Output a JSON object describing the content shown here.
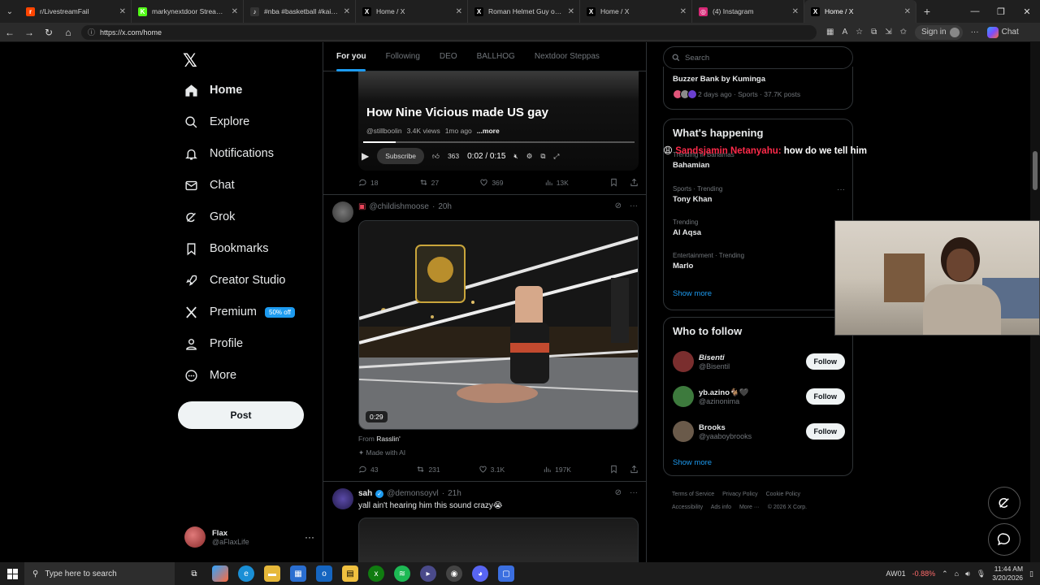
{
  "browser": {
    "tabs": [
      {
        "title": "r/LivestreamFail",
        "fav": "r",
        "color": "#ff4500"
      },
      {
        "title": "markynextdoor Stream - Wa",
        "fav": "K",
        "color": "#53fc18"
      },
      {
        "title": "#nba #basketball #kaijones",
        "fav": "♪",
        "color": "#333333"
      },
      {
        "title": "Home / X",
        "fav": "X",
        "color": "#000000"
      },
      {
        "title": "Roman Helmet Guy on X: \"",
        "fav": "X",
        "color": "#000000"
      },
      {
        "title": "Home / X",
        "fav": "X",
        "color": "#000000"
      },
      {
        "title": "(4) Instagram",
        "fav": "◎",
        "color": "#d62976"
      },
      {
        "title": "Home / X",
        "fav": "X",
        "color": "#000000"
      }
    ],
    "url": "https://x.com/home",
    "sign_in": "Sign in",
    "chat": "Chat"
  },
  "sidebar": {
    "items": [
      {
        "label": "Home"
      },
      {
        "label": "Explore"
      },
      {
        "label": "Notifications"
      },
      {
        "label": "Chat"
      },
      {
        "label": "Grok"
      },
      {
        "label": "Bookmarks"
      },
      {
        "label": "Creator Studio"
      },
      {
        "label": "Premium"
      },
      {
        "label": "Profile"
      },
      {
        "label": "More"
      }
    ],
    "premium_badge": "50% off",
    "post_button": "Post",
    "account": {
      "name": "Flax",
      "handle": "@aFlaxLife"
    }
  },
  "feed": {
    "tabs": [
      "For you",
      "Following",
      "DEO",
      "BALLHOG",
      "Nextdoor Steppas"
    ],
    "video1": {
      "title": "How Nine Vicious made US gay",
      "channel": "@stillboolin",
      "views": "3.4K views",
      "ago": "1mo ago",
      "more": "...more",
      "subscribe": "Subscribe",
      "likes": "363",
      "time": "0:02 / 0:15",
      "progress": 0.12
    },
    "post1_actions": {
      "replies": "18",
      "reposts": "27",
      "likes": "369",
      "views": "13K"
    },
    "post2": {
      "handle": "@childishmoose",
      "time": "20h",
      "duration": "0:29",
      "from_label": "From",
      "from_source": "Rasslin'",
      "made_with_ai": "Made with AI",
      "actions": {
        "replies": "43",
        "reposts": "231",
        "likes": "3.1K",
        "views": "197K"
      }
    },
    "post3": {
      "name": "sah",
      "handle": "@demonsoyvl",
      "time": "21h",
      "text": "yall ain't hearing him this sound crazy😭"
    }
  },
  "right": {
    "search_placeholder": "Search",
    "buzzer": {
      "title": "Buzzer Bank by Kuminga",
      "meta": "2 days ago · Sports · 37.7K posts"
    },
    "whats_happening": "What's happening",
    "trends": [
      {
        "category": "Trending in Bahamas",
        "name": "Bahamian"
      },
      {
        "category": "Sports · Trending",
        "name": "Tony Khan"
      },
      {
        "category": "Trending",
        "name": "Al Aqsa"
      },
      {
        "category": "Entertainment · Trending",
        "name": "Marlo"
      }
    ],
    "show_more": "Show more",
    "who_to_follow": "Who to follow",
    "follow_label": "Follow",
    "suggestions": [
      {
        "name": "Bisenti",
        "handle": "@Bisentil",
        "color": "#7a2e2e"
      },
      {
        "name": "yb.azino🐐🖤",
        "handle": "@azinonima",
        "color": "#3d7a3d"
      },
      {
        "name": "Brooks",
        "handle": "@yaaboybrooks",
        "color": "#6a5a4a"
      }
    ],
    "footer": [
      "Terms of Service",
      "Privacy Policy",
      "Cookie Policy",
      "Accessibility",
      "Ads info",
      "More ···",
      "© 2026 X Corp."
    ]
  },
  "overlay": {
    "user": "Sandsjamin Netanyahu:",
    "message": "how do we tell him"
  },
  "taskbar": {
    "search": "Type here to search",
    "stock": "AW01",
    "change": "-0.88%",
    "time": "11:44 AM",
    "date": "3/20/2026"
  }
}
